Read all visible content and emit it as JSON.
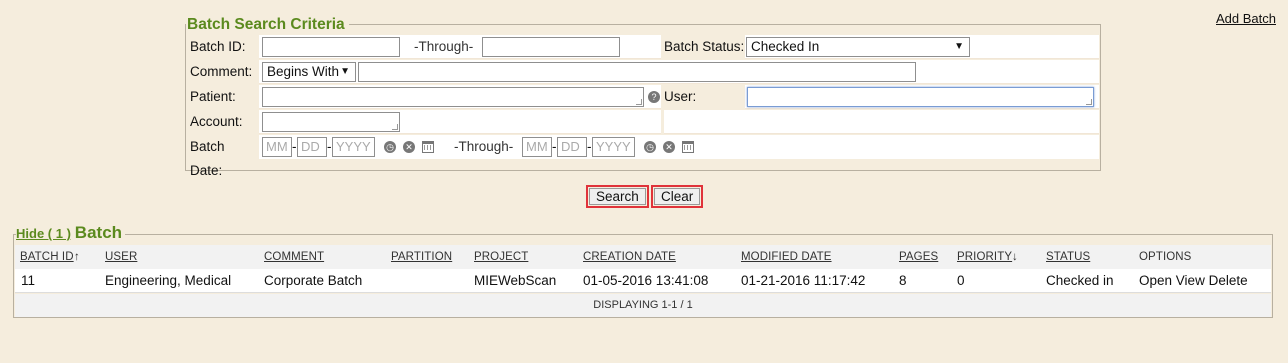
{
  "header": {
    "add_batch": "Add Batch"
  },
  "criteria": {
    "legend": "Batch Search Criteria",
    "batch_id_label": "Batch ID:",
    "through_label": "-Through-",
    "batch_id_from": "",
    "batch_id_to": "",
    "batch_status_label": "Batch Status:",
    "batch_status_value": "Checked In",
    "comment_label": "Comment:",
    "comment_mode": "Begins With",
    "comment_value": "",
    "patient_label": "Patient:",
    "patient_value": "",
    "user_label": "User:",
    "user_value": "",
    "account_label": "Account:",
    "account_value": "",
    "batch_date_label": "Batch Date:",
    "mm_placeholder": "MM",
    "dd_placeholder": "DD",
    "yyyy_placeholder": "YYYY",
    "date_through_label": "-Through-",
    "date_sep": "-"
  },
  "buttons": {
    "search": "Search",
    "clear": "Clear"
  },
  "batch": {
    "hide_link": "Hide ( 1 )",
    "title": "Batch",
    "columns": {
      "batch_id": "BATCH ID",
      "user": "USER",
      "comment": "COMMENT",
      "partition": "PARTITION",
      "project": "PROJECT",
      "creation_date": "CREATION DATE",
      "modified_date": "MODIFIED DATE",
      "pages": "PAGES",
      "priority": "PRIORITY",
      "status": "STATUS",
      "options": "OPTIONS"
    },
    "sort_up_arrow": "↑",
    "sort_down_arrow": "↓",
    "rows": [
      {
        "batch_id": "11",
        "user": "Engineering, Medical",
        "comment": "Corporate Batch",
        "partition": "",
        "project": "MIEWebScan",
        "creation_date": "01-05-2016 13:41:08",
        "modified_date": "01-21-2016 11:17:42",
        "pages": "8",
        "priority": "0",
        "status": "Checked in",
        "open": "Open",
        "view": "View",
        "delete": "Delete"
      }
    ],
    "footer": "DISPLAYING 1-1 / 1"
  },
  "colors": {
    "background": "#f5eddd",
    "accent_green": "#5b8a1e",
    "highlight_red": "#e0333a"
  },
  "icons": [
    "help-icon",
    "clock-icon",
    "clear-icon",
    "calendar-icon",
    "sort-asc-icon",
    "sort-desc-icon"
  ]
}
